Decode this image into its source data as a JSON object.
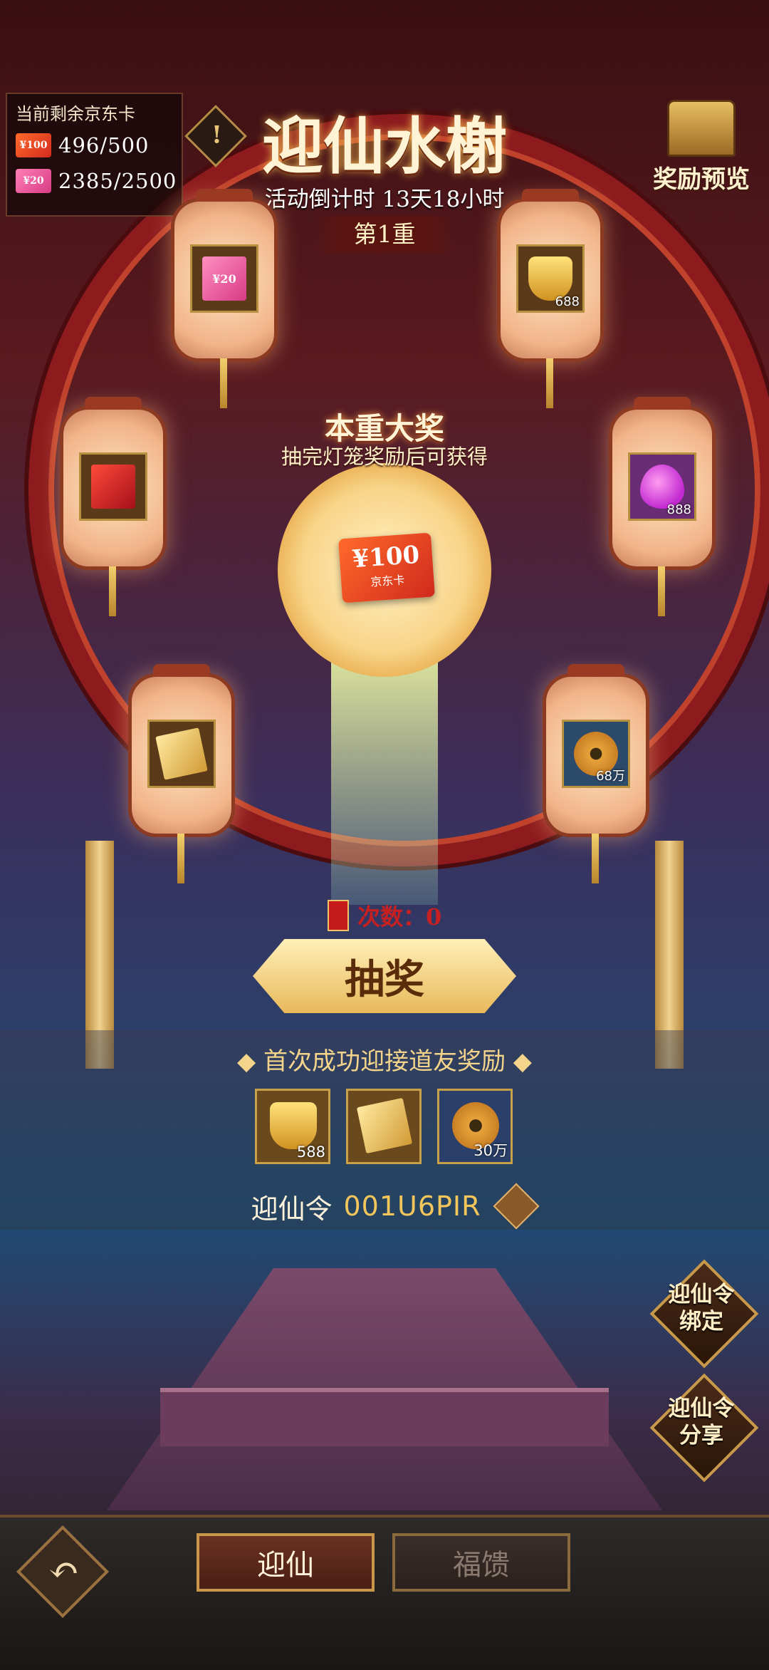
{
  "wallet": {
    "title": "当前剩余京东卡",
    "rows": [
      {
        "card": "¥100",
        "value": "496/500"
      },
      {
        "card": "¥20",
        "value": "2385/2500"
      }
    ]
  },
  "header": {
    "title": "迎仙水榭",
    "countdown": "活动倒计时 13天18小时",
    "tier": "第1重",
    "info_icon": "!",
    "preview_label": "奖励预览"
  },
  "lanterns": [
    {
      "icon": "jd-card-20-icon",
      "card_label": "¥20",
      "qty": ""
    },
    {
      "icon": "gold-ingot-icon",
      "qty": "688"
    },
    {
      "icon": "red-envelope-icon",
      "qty": ""
    },
    {
      "icon": "purple-crystal-icon",
      "qty": "888"
    },
    {
      "icon": "banknotes-icon",
      "qty": ""
    },
    {
      "icon": "copper-coin-icon",
      "qty": "68万"
    }
  ],
  "grand_prize": {
    "title": "本重大奖",
    "subtitle": "抽完灯笼奖励后可获得",
    "card_amount": "¥100",
    "card_name": "京东卡"
  },
  "draw": {
    "count_label": "次数：0",
    "button_label": "抽奖"
  },
  "first_reward": {
    "title": "◆ 首次成功迎接道友奖励 ◆",
    "items": [
      {
        "icon": "gold-ingot-icon",
        "qty": "588"
      },
      {
        "icon": "banknotes-icon",
        "qty": ""
      },
      {
        "icon": "copper-coin-icon",
        "qty": "30万"
      }
    ],
    "code_label": "迎仙令",
    "code_value": "001U6PIR"
  },
  "side_buttons": {
    "bind": "迎仙令\n绑定",
    "share": "迎仙令\n分享"
  },
  "bottom": {
    "back_icon": "↶",
    "tabs": [
      "迎仙",
      "福馈"
    ]
  },
  "colors": {
    "accent": "#f2c65a",
    "ring": "#8d1b1e",
    "active_tab": "#6a3222"
  }
}
